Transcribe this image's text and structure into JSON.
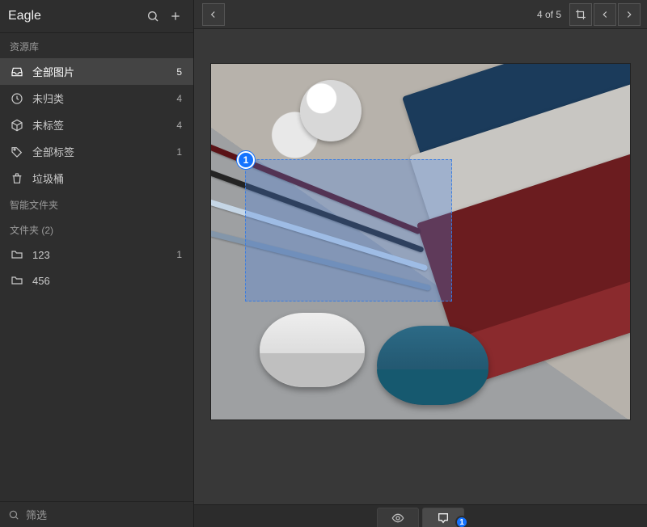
{
  "app": {
    "title": "Eagle"
  },
  "sidebar": {
    "library_header": "资源库",
    "items": [
      {
        "label": "全部图片",
        "count": "5",
        "icon": "inbox-icon",
        "selected": true
      },
      {
        "label": "未归类",
        "count": "4",
        "icon": "clock-icon"
      },
      {
        "label": "未标签",
        "count": "4",
        "icon": "cube-icon"
      },
      {
        "label": "全部标签",
        "count": "1",
        "icon": "tag-icon"
      },
      {
        "label": "垃圾桶",
        "count": "",
        "icon": "trash-icon"
      }
    ],
    "smart_header": "智能文件夹",
    "folders_header": "文件夹 (2)",
    "folders": [
      {
        "label": "123",
        "count": "1"
      },
      {
        "label": "456",
        "count": ""
      }
    ],
    "filter_label": "筛选"
  },
  "viewer": {
    "counter": "4 of 5",
    "annotation_number": "1",
    "comments_badge": "1"
  }
}
